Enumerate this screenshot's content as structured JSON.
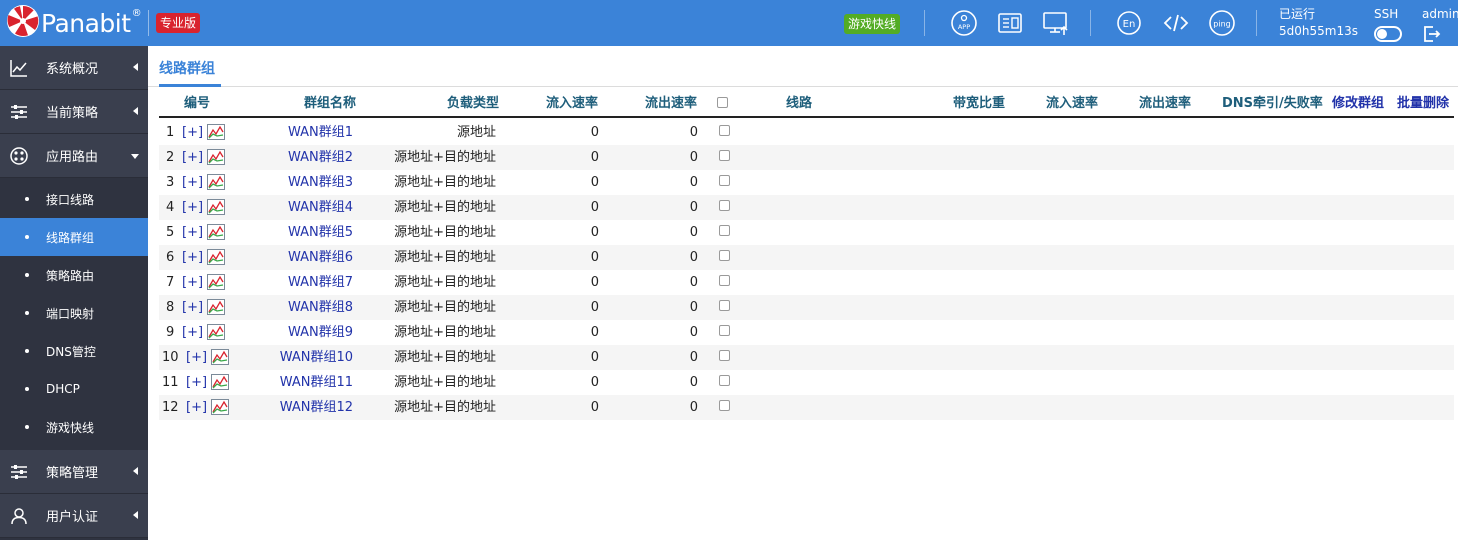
{
  "header": {
    "brand": "Panabit",
    "brand_reg": "®",
    "edition": "专业版",
    "game_button": "游戏快线",
    "uptime_label": "已运行",
    "uptime_value": "5d0h55m13s",
    "ssh_label": "SSH",
    "user": "admin",
    "icons": [
      "app-icon",
      "report-icon",
      "monitor-icon",
      "language-en-icon",
      "code-icon",
      "ping-icon",
      "logout-icon"
    ],
    "icon_text": {
      "app": "APP",
      "en": "En",
      "ping": "ping"
    }
  },
  "colors": {
    "topbar": "#3b83d8",
    "sidebar": "#2f3340",
    "active": "#3b83d8",
    "edition": "#d9232e",
    "game": "#53ac24",
    "link": "#2233aa"
  },
  "sidebar": {
    "main": [
      {
        "label": "系统概况",
        "icon": "chart-line-icon"
      },
      {
        "label": "当前策略",
        "icon": "sliders-icon"
      },
      {
        "label": "应用路由",
        "icon": "route-icon",
        "expanded": true
      },
      {
        "label": "策略管理",
        "icon": "sliders-icon"
      },
      {
        "label": "用户认证",
        "icon": "user-icon"
      }
    ],
    "sub": [
      {
        "label": "接口线路"
      },
      {
        "label": "线路群组",
        "active": true
      },
      {
        "label": "策略路由"
      },
      {
        "label": "端口映射"
      },
      {
        "label": "DNS管控"
      },
      {
        "label": "DHCP"
      },
      {
        "label": "游戏快线"
      }
    ]
  },
  "tab": {
    "label": "线路群组"
  },
  "table": {
    "headers": {
      "id": "编号",
      "name": "群组名称",
      "lb_type": "负载类型",
      "in_rate": "流入速率",
      "out_rate": "流出速率",
      "line": "线路",
      "bw_ratio": "带宽比重",
      "line_in": "流入速率",
      "line_out": "流出速率",
      "dns": "DNS牵引/失败率",
      "edit": "修改群组",
      "batch_delete": "批量删除"
    },
    "add_label": "[+]",
    "rows": [
      {
        "id": "1",
        "name": "WAN群组1",
        "lb_type": "源地址",
        "in": "0",
        "out": "0"
      },
      {
        "id": "2",
        "name": "WAN群组2",
        "lb_type": "源地址+目的地址",
        "in": "0",
        "out": "0"
      },
      {
        "id": "3",
        "name": "WAN群组3",
        "lb_type": "源地址+目的地址",
        "in": "0",
        "out": "0"
      },
      {
        "id": "4",
        "name": "WAN群组4",
        "lb_type": "源地址+目的地址",
        "in": "0",
        "out": "0"
      },
      {
        "id": "5",
        "name": "WAN群组5",
        "lb_type": "源地址+目的地址",
        "in": "0",
        "out": "0"
      },
      {
        "id": "6",
        "name": "WAN群组6",
        "lb_type": "源地址+目的地址",
        "in": "0",
        "out": "0"
      },
      {
        "id": "7",
        "name": "WAN群组7",
        "lb_type": "源地址+目的地址",
        "in": "0",
        "out": "0"
      },
      {
        "id": "8",
        "name": "WAN群组8",
        "lb_type": "源地址+目的地址",
        "in": "0",
        "out": "0"
      },
      {
        "id": "9",
        "name": "WAN群组9",
        "lb_type": "源地址+目的地址",
        "in": "0",
        "out": "0"
      },
      {
        "id": "10",
        "name": "WAN群组10",
        "lb_type": "源地址+目的地址",
        "in": "0",
        "out": "0"
      },
      {
        "id": "11",
        "name": "WAN群组11",
        "lb_type": "源地址+目的地址",
        "in": "0",
        "out": "0"
      },
      {
        "id": "12",
        "name": "WAN群组12",
        "lb_type": "源地址+目的地址",
        "in": "0",
        "out": "0"
      }
    ]
  }
}
